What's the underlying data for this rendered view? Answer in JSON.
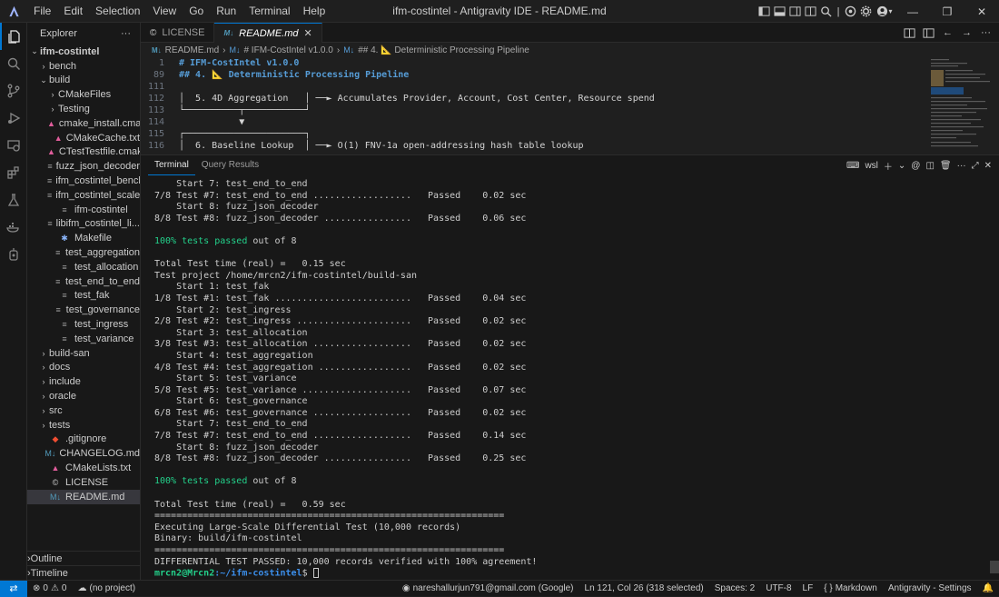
{
  "app": {
    "window_title": "ifm-costintel - Antigravity IDE - README.md",
    "menu": [
      "File",
      "Edit",
      "Selection",
      "View",
      "Go",
      "Run",
      "Terminal",
      "Help"
    ]
  },
  "sidebar": {
    "title": "Explorer",
    "more": "···",
    "root": "ifm-costintel",
    "items": [
      {
        "label": "bench",
        "kind": "folder",
        "depth": 1,
        "open": false
      },
      {
        "label": "build",
        "kind": "folder",
        "depth": 1,
        "open": true
      },
      {
        "label": "CMakeFiles",
        "kind": "folder",
        "depth": 2,
        "open": false
      },
      {
        "label": "Testing",
        "kind": "folder",
        "depth": 2,
        "open": false
      },
      {
        "label": "cmake_install.cma...",
        "kind": "cmake",
        "depth": 2
      },
      {
        "label": "CMakeCache.txt",
        "kind": "cmake",
        "depth": 2
      },
      {
        "label": "CTestTestfile.cmake",
        "kind": "cmake",
        "depth": 2
      },
      {
        "label": "fuzz_json_decoder",
        "kind": "file",
        "depth": 2
      },
      {
        "label": "ifm_costintel_bench",
        "kind": "file",
        "depth": 2
      },
      {
        "label": "ifm_costintel_scale",
        "kind": "file",
        "depth": 2
      },
      {
        "label": "ifm-costintel",
        "kind": "file",
        "depth": 2
      },
      {
        "label": "libifm_costintel_li...",
        "kind": "file",
        "depth": 2
      },
      {
        "label": "Makefile",
        "kind": "makefile",
        "depth": 2
      },
      {
        "label": "test_aggregation",
        "kind": "file",
        "depth": 2
      },
      {
        "label": "test_allocation",
        "kind": "file",
        "depth": 2
      },
      {
        "label": "test_end_to_end",
        "kind": "file",
        "depth": 2
      },
      {
        "label": "test_fak",
        "kind": "file",
        "depth": 2
      },
      {
        "label": "test_governance",
        "kind": "file",
        "depth": 2
      },
      {
        "label": "test_ingress",
        "kind": "file",
        "depth": 2
      },
      {
        "label": "test_variance",
        "kind": "file",
        "depth": 2
      },
      {
        "label": "build-san",
        "kind": "folder",
        "depth": 1,
        "open": false
      },
      {
        "label": "docs",
        "kind": "folder",
        "depth": 1,
        "open": false
      },
      {
        "label": "include",
        "kind": "folder",
        "depth": 1,
        "open": false
      },
      {
        "label": "oracle",
        "kind": "folder",
        "depth": 1,
        "open": false
      },
      {
        "label": "src",
        "kind": "folder",
        "depth": 1,
        "open": false
      },
      {
        "label": "tests",
        "kind": "folder",
        "depth": 1,
        "open": false
      },
      {
        "label": ".gitignore",
        "kind": "git",
        "depth": 1
      },
      {
        "label": "CHANGELOG.md",
        "kind": "md",
        "depth": 1
      },
      {
        "label": "CMakeLists.txt",
        "kind": "cmake",
        "depth": 1
      },
      {
        "label": "LICENSE",
        "kind": "license",
        "depth": 1
      },
      {
        "label": "README.md",
        "kind": "md",
        "depth": 1,
        "selected": true
      }
    ],
    "outline": "Outline",
    "timeline": "Timeline"
  },
  "editor": {
    "tabs": [
      {
        "label": "LICENSE",
        "active": false
      },
      {
        "label": "README.md",
        "active": true
      }
    ],
    "breadcrumb": [
      "README.md",
      "# IFM-CostIntel v1.0.0",
      "## 4. 📐 Deterministic Processing Pipeline"
    ],
    "lines": [
      {
        "n": "1",
        "text": "# IFM-CostIntel v1.0.0",
        "heading": true
      },
      {
        "n": "89",
        "text": "## 4. 📐 Deterministic Processing Pipeline",
        "heading": true
      },
      {
        "n": "111",
        "text": "",
        "heading": false
      },
      {
        "n": "112",
        "text": "│  5. 4D Aggregation   │ ──► Accumulates Provider, Account, Cost Center, Resource spend",
        "heading": false
      },
      {
        "n": "113",
        "text": "└──────────┬───────────┘",
        "heading": false
      },
      {
        "n": "114",
        "text": "           ▼",
        "heading": false
      },
      {
        "n": "115",
        "text": "┌──────────────────────┐",
        "heading": false
      },
      {
        "n": "116",
        "text": "│  6. Baseline Lookup  │ ──► O(1) FNV-1a open-addressing hash table lookup",
        "heading": false
      }
    ]
  },
  "panel": {
    "tabs": [
      "Terminal",
      "Query Results"
    ],
    "shell": "wsl",
    "terminal_lines": [
      {
        "text": "    Start 7: test_end_to_end"
      },
      {
        "text": "7/8 Test #7: test_end_to_end ..................   Passed    0.02 sec"
      },
      {
        "text": "    Start 8: fuzz_json_decoder"
      },
      {
        "text": "8/8 Test #8: fuzz_json_decoder ................   Passed    0.06 sec"
      },
      {
        "text": ""
      },
      {
        "text": "100% tests passed",
        "green": true,
        "suffix": " out of 8"
      },
      {
        "text": ""
      },
      {
        "text": "Total Test time (real) =   0.15 sec"
      },
      {
        "text": "Test project /home/mrcn2/ifm-costintel/build-san"
      },
      {
        "text": "    Start 1: test_fak"
      },
      {
        "text": "1/8 Test #1: test_fak .........................   Passed    0.04 sec"
      },
      {
        "text": "    Start 2: test_ingress"
      },
      {
        "text": "2/8 Test #2: test_ingress .....................   Passed    0.02 sec"
      },
      {
        "text": "    Start 3: test_allocation"
      },
      {
        "text": "3/8 Test #3: test_allocation ..................   Passed    0.02 sec"
      },
      {
        "text": "    Start 4: test_aggregation"
      },
      {
        "text": "4/8 Test #4: test_aggregation .................   Passed    0.02 sec"
      },
      {
        "text": "    Start 5: test_variance"
      },
      {
        "text": "5/8 Test #5: test_variance ....................   Passed    0.07 sec"
      },
      {
        "text": "    Start 6: test_governance"
      },
      {
        "text": "6/8 Test #6: test_governance ..................   Passed    0.02 sec"
      },
      {
        "text": "    Start 7: test_end_to_end"
      },
      {
        "text": "7/8 Test #7: test_end_to_end ..................   Passed    0.14 sec"
      },
      {
        "text": "    Start 8: fuzz_json_decoder"
      },
      {
        "text": "8/8 Test #8: fuzz_json_decoder ................   Passed    0.25 sec"
      },
      {
        "text": ""
      },
      {
        "text": "100% tests passed",
        "green": true,
        "suffix": " out of 8"
      },
      {
        "text": ""
      },
      {
        "text": "Total Test time (real) =   0.59 sec"
      },
      {
        "text": "================================================================"
      },
      {
        "text": "Executing Large-Scale Differential Test (10,000 records)"
      },
      {
        "text": "Binary: build/ifm-costintel"
      },
      {
        "text": "================================================================"
      },
      {
        "text": "DIFFERENTIAL TEST PASSED: 10,000 records verified with 100% agreement!"
      }
    ],
    "prompt_user": "mrcn2@Mrcn2",
    "prompt_path": ":~/ifm-costintel",
    "prompt_symbol": "$"
  },
  "status": {
    "remote_icon": "remote-icon",
    "errors": "0",
    "warnings": "0",
    "project": "(no project)",
    "account": "nareshallurjun791@gmail.com (Google)",
    "position": "Ln 121, Col 26 (318 selected)",
    "spaces": "Spaces: 2",
    "encoding": "UTF-8",
    "eol": "LF",
    "language": "Markdown",
    "settings": "Antigravity - Settings"
  },
  "colors": {
    "accent": "#0078d4",
    "pass_green": "#23d18b",
    "heading_blue": "#569cd6"
  }
}
